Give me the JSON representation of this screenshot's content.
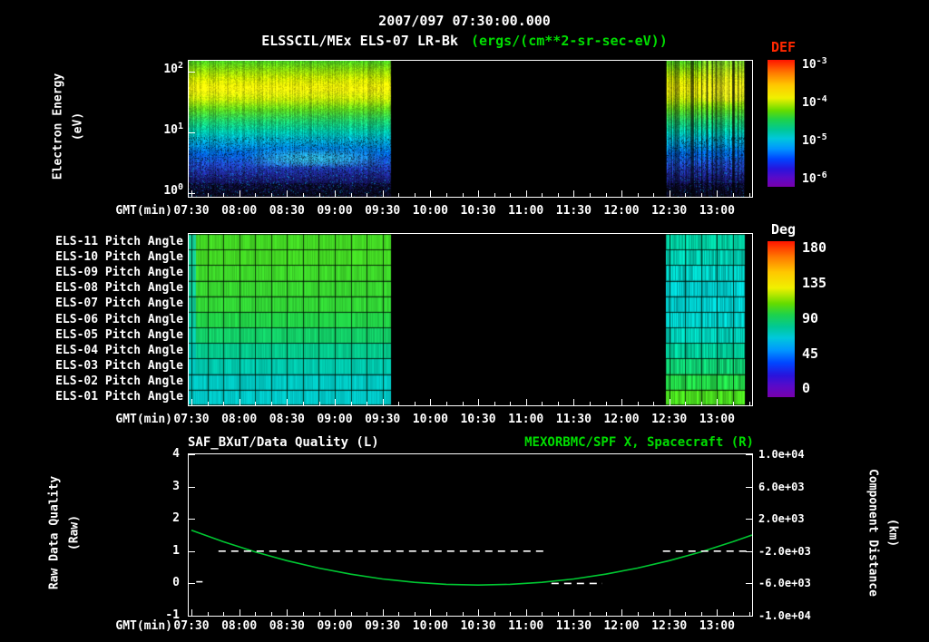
{
  "colors": {
    "background": "#000000",
    "text": "#ffffff",
    "accent_green": "#00dd00",
    "def_title_red": "#ff2800",
    "curve_green": "#00c832"
  },
  "title": {
    "datetime": "2007/097 07:30:00.000",
    "instrument": "ELSSCIL/MEx ELS-07 LR-Bk",
    "units": "(ergs/(cm**2-sr-sec-eV))"
  },
  "time_axis": {
    "label": "GMT(min)",
    "ticks": [
      "07:30",
      "08:00",
      "08:30",
      "09:00",
      "09:30",
      "10:00",
      "10:30",
      "11:00",
      "11:30",
      "12:00",
      "12:30",
      "13:00"
    ]
  },
  "panel_spectrogram": {
    "ylabel_line1": "Electron Energy",
    "ylabel_line2": "(eV)",
    "yticks": [
      {
        "base": "10",
        "exp": "2"
      },
      {
        "base": "10",
        "exp": "1"
      },
      {
        "base": "10",
        "exp": "0"
      }
    ],
    "colorbar": {
      "title": "DEF",
      "ticks": [
        {
          "base": "10",
          "exp": "-3"
        },
        {
          "base": "10",
          "exp": "-4"
        },
        {
          "base": "10",
          "exp": "-5"
        },
        {
          "base": "10",
          "exp": "-6"
        }
      ]
    }
  },
  "panel_pitch": {
    "row_labels": [
      "ELS-11 Pitch Angle",
      "ELS-10 Pitch Angle",
      "ELS-09 Pitch Angle",
      "ELS-08 Pitch Angle",
      "ELS-07 Pitch Angle",
      "ELS-06 Pitch Angle",
      "ELS-05 Pitch Angle",
      "ELS-04 Pitch Angle",
      "ELS-03 Pitch Angle",
      "ELS-02 Pitch Angle",
      "ELS-01 Pitch Angle"
    ],
    "colorbar": {
      "title": "Deg",
      "ticks": [
        "180",
        "135",
        "90",
        "45",
        "0"
      ]
    }
  },
  "panel_line": {
    "title_left": "SAF_BXuT/Data Quality (L)",
    "title_right": "MEXORBMC/SPF X, Spacecraft (R)",
    "ylabel_left_line1": "Raw Data Quality",
    "ylabel_left_line2": "(Raw)",
    "ylabel_right_line1": "Component Distance",
    "ylabel_right_line2": "(km)",
    "yticks_left": [
      "4",
      "3",
      "2",
      "1",
      "0",
      "-1"
    ],
    "yticks_right": [
      "1.0e+04",
      "6.0e+03",
      "2.0e+03",
      "-2.0e+03",
      "-6.0e+03",
      "-1.0e+04"
    ]
  },
  "colormap_stops": [
    [
      0,
      "#ff1400"
    ],
    [
      0.1,
      "#ff7800"
    ],
    [
      0.2,
      "#ffc800"
    ],
    [
      0.3,
      "#f0f000"
    ],
    [
      0.4,
      "#64dc00"
    ],
    [
      0.47,
      "#1ed24a"
    ],
    [
      0.55,
      "#00c896"
    ],
    [
      0.62,
      "#00c8dc"
    ],
    [
      0.7,
      "#0096ff"
    ],
    [
      0.78,
      "#0046ff"
    ],
    [
      0.86,
      "#2814dc"
    ],
    [
      0.93,
      "#5a0ac8"
    ],
    [
      1,
      "#7800aa"
    ]
  ],
  "chart_data": [
    {
      "type": "heatmap",
      "name": "electron_energy_spectrogram",
      "title": "ELSSCIL/MEx ELS-07 LR-Bk",
      "units": "ergs/(cm**2-sr-sec-eV)",
      "start_time": "2007/097 07:30:00.000",
      "x_axis": {
        "label": "GMT(min)",
        "start": "07:30",
        "end": "13:21",
        "tick_interval_min": 30
      },
      "y_axis": {
        "label": "Electron Energy (eV)",
        "scale": "log",
        "min": 1,
        "max": 100,
        "tick_values": [
          1,
          10,
          100
        ]
      },
      "colorbar": {
        "label": "DEF",
        "min": 1e-06,
        "max": 0.001,
        "tick_values": [
          0.001,
          0.0001,
          1e-05,
          1e-06
        ]
      },
      "data_intervals": [
        {
          "start": "07:30",
          "end": "09:35",
          "t_min": [
            0,
            125
          ]
        },
        {
          "start": "12:28",
          "end": "13:17",
          "t_min": [
            298,
            347
          ]
        }
      ],
      "energy_profile_colors": [
        [
          0,
          "#46c81e"
        ],
        [
          0.06,
          "#82d20a"
        ],
        [
          0.13,
          "#c8e600"
        ],
        [
          0.2,
          "#f0f000"
        ],
        [
          0.28,
          "#b4e600"
        ],
        [
          0.36,
          "#5ad21e"
        ],
        [
          0.44,
          "#1ec864"
        ],
        [
          0.52,
          "#00bea0"
        ],
        [
          0.6,
          "#00a0d2"
        ],
        [
          0.68,
          "#0064dc"
        ],
        [
          0.76,
          "#1e46c8"
        ],
        [
          0.83,
          "#1e2896"
        ],
        [
          0.9,
          "#141460"
        ],
        [
          1,
          "#0a0a28"
        ]
      ],
      "features": [
        {
          "desc": "bright yellow-green high flux band",
          "energy_eV": [
            15,
            70
          ]
        },
        {
          "desc": "cyan arc structure",
          "energy_eV": [
            3,
            6
          ],
          "time": [
            "08:05",
            "09:25"
          ]
        },
        {
          "desc": "dark low-flux region below 2 eV"
        },
        {
          "desc": "vertical striping in second interval"
        }
      ]
    },
    {
      "type": "heatmap",
      "name": "pitch_angle_matrix",
      "rows": [
        "ELS-11 Pitch Angle",
        "ELS-10 Pitch Angle",
        "ELS-09 Pitch Angle",
        "ELS-08 Pitch Angle",
        "ELS-07 Pitch Angle",
        "ELS-06 Pitch Angle",
        "ELS-05 Pitch Angle",
        "ELS-04 Pitch Angle",
        "ELS-03 Pitch Angle",
        "ELS-02 Pitch Angle",
        "ELS-01 Pitch Angle"
      ],
      "colorbar": {
        "label": "Deg",
        "min": 0,
        "max": 180,
        "tick_values": [
          180,
          135,
          90,
          45,
          0
        ]
      },
      "data_intervals": [
        {
          "start": "07:30",
          "end": "09:35",
          "t_min": [
            0,
            125
          ]
        },
        {
          "start": "12:28",
          "end": "13:17",
          "t_min": [
            298,
            347
          ]
        }
      ],
      "row_values_deg": {
        "interval1": [
          102,
          102,
          101,
          100,
          99,
          96,
          90,
          83,
          77,
          73,
          72
        ],
        "interval2": [
          80,
          77,
          74,
          72,
          72,
          73,
          76,
          81,
          88,
          96,
          103
        ]
      }
    },
    {
      "type": "line",
      "name": "quality_and_spacecraft_position",
      "titles": {
        "left": "SAF_BXuT/Data Quality (L)",
        "right": "MEXORBMC/SPF X, Spacecraft (R)"
      },
      "x_axis": {
        "label": "GMT(min)",
        "start": "07:30",
        "end": "13:21"
      },
      "y_axis_left": {
        "label": "Raw Data Quality (Raw)",
        "min": -1,
        "max": 4,
        "ticks": [
          4,
          3,
          2,
          1,
          0,
          -1
        ]
      },
      "y_axis_right": {
        "label": "Component Distance (km)",
        "min": -10000,
        "max": 10000,
        "ticks": [
          10000,
          6000,
          2000,
          -2000,
          -6000,
          -10000
        ]
      },
      "series": [
        {
          "name": "SAF_BXuT/Data Quality",
          "axis": "left",
          "color": "#ffffff",
          "style": "dashed",
          "segments": [
            {
              "t_min": [
                3,
                7
              ],
              "value": 0.05
            },
            {
              "t_min": [
                17,
                224
              ],
              "value": 1
            },
            {
              "t_min": [
                226,
                258
              ],
              "value": 0
            },
            {
              "t_min": [
                296,
                351
              ],
              "value": 1
            }
          ]
        },
        {
          "name": "MEXORBMC/SPF X Spacecraft",
          "axis": "right",
          "color": "#00c832",
          "style": "solid",
          "t_min": [
            0,
            20,
            40,
            60,
            80,
            100,
            120,
            140,
            160,
            180,
            200,
            220,
            240,
            260,
            280,
            300,
            320,
            340,
            352
          ],
          "values_km": [
            591,
            -834,
            -2092,
            -3182,
            -4104,
            -4859,
            -5445,
            -5865,
            -6116,
            -6200,
            -6116,
            -5865,
            -5445,
            -4859,
            -4104,
            -3182,
            -2092,
            -834,
            0
          ]
        }
      ]
    }
  ]
}
